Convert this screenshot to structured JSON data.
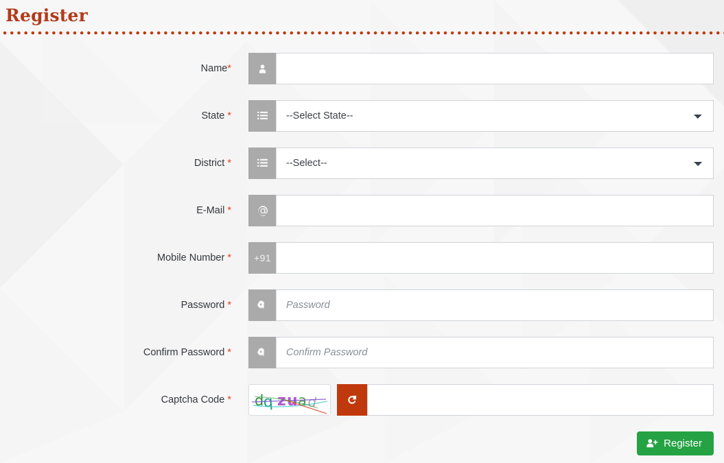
{
  "page": {
    "title": "Register",
    "accent_color": "#b33a1a",
    "divider_dot_color": "#c0390d",
    "background_color": "#f7f7f7"
  },
  "form": {
    "required_marker": "*",
    "fields": [
      {
        "id": "name",
        "label": "Name",
        "label_suffix": "*",
        "label_space": "",
        "type": "text",
        "icon": "user-icon",
        "value": "",
        "placeholder": ""
      },
      {
        "id": "state",
        "label": "State",
        "label_suffix": "*",
        "label_space": " ",
        "type": "select",
        "icon": "list-icon",
        "selected": "--Select State--",
        "options": [
          "--Select State--"
        ]
      },
      {
        "id": "district",
        "label": "District",
        "label_suffix": "*",
        "label_space": " ",
        "type": "select",
        "icon": "list-icon",
        "selected": "--Select--",
        "options": [
          "--Select--"
        ]
      },
      {
        "id": "email",
        "label": "E-Mail",
        "label_suffix": "*",
        "label_space": " ",
        "type": "text",
        "icon": "at-icon",
        "value": "",
        "placeholder": ""
      },
      {
        "id": "mobile",
        "label": "Mobile Number",
        "label_suffix": "*",
        "label_space": " ",
        "type": "text",
        "icon": "country-code-text",
        "prefix_text": "+91",
        "value": "",
        "placeholder": ""
      },
      {
        "id": "password",
        "label": "Password",
        "label_suffix": "*",
        "label_space": " ",
        "type": "password",
        "icon": "key-icon",
        "value": "",
        "placeholder": "Password"
      },
      {
        "id": "confirm-password",
        "label": "Confirm Password",
        "label_suffix": "*",
        "label_space": " ",
        "type": "password",
        "icon": "key-icon",
        "value": "",
        "placeholder": "Confirm Password"
      }
    ],
    "captcha": {
      "label": "Captcha Code",
      "label_suffix": "*",
      "label_space": " ",
      "code_text": "dqzuad",
      "characters": [
        {
          "char": "d",
          "color": "#2f8f3f"
        },
        {
          "char": "q",
          "color": "#1f9d8a"
        },
        {
          "char": "z",
          "color": "#b05bd0"
        },
        {
          "char": "u",
          "color": "#b05bd0"
        },
        {
          "char": "a",
          "color": "#4a9c4a"
        },
        {
          "char": "d",
          "color": "#9aa0a6"
        }
      ],
      "refresh_button_label": "refresh-icon",
      "refresh_button_color": "#c0390d",
      "input_value": "",
      "input_placeholder": ""
    },
    "submit": {
      "label": "Register",
      "icon": "user-plus-icon",
      "color": "#25a244"
    }
  }
}
